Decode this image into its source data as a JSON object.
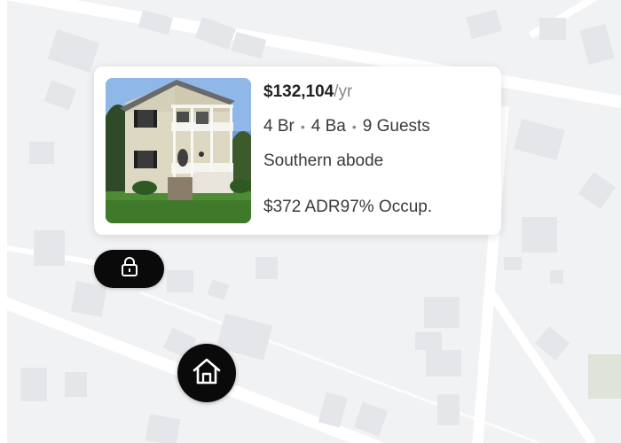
{
  "listing_card": {
    "price_amount": "$132,104",
    "price_period": "/yr",
    "bedrooms": "4 Br",
    "bathrooms": "4 Ba",
    "guests": "9 Guests",
    "separator": "•",
    "name": "Southern abode",
    "adr": "$372 ADR",
    "occupancy": "97% Occup."
  },
  "markers": {
    "lock_icon": "lock-icon",
    "home_icon": "home-icon"
  },
  "colors": {
    "map_background": "#f1f2f4",
    "road": "#ffffff",
    "building": "#e3e5e8",
    "marker": "#0a0a0a",
    "price_period": "#8a8a8a"
  }
}
